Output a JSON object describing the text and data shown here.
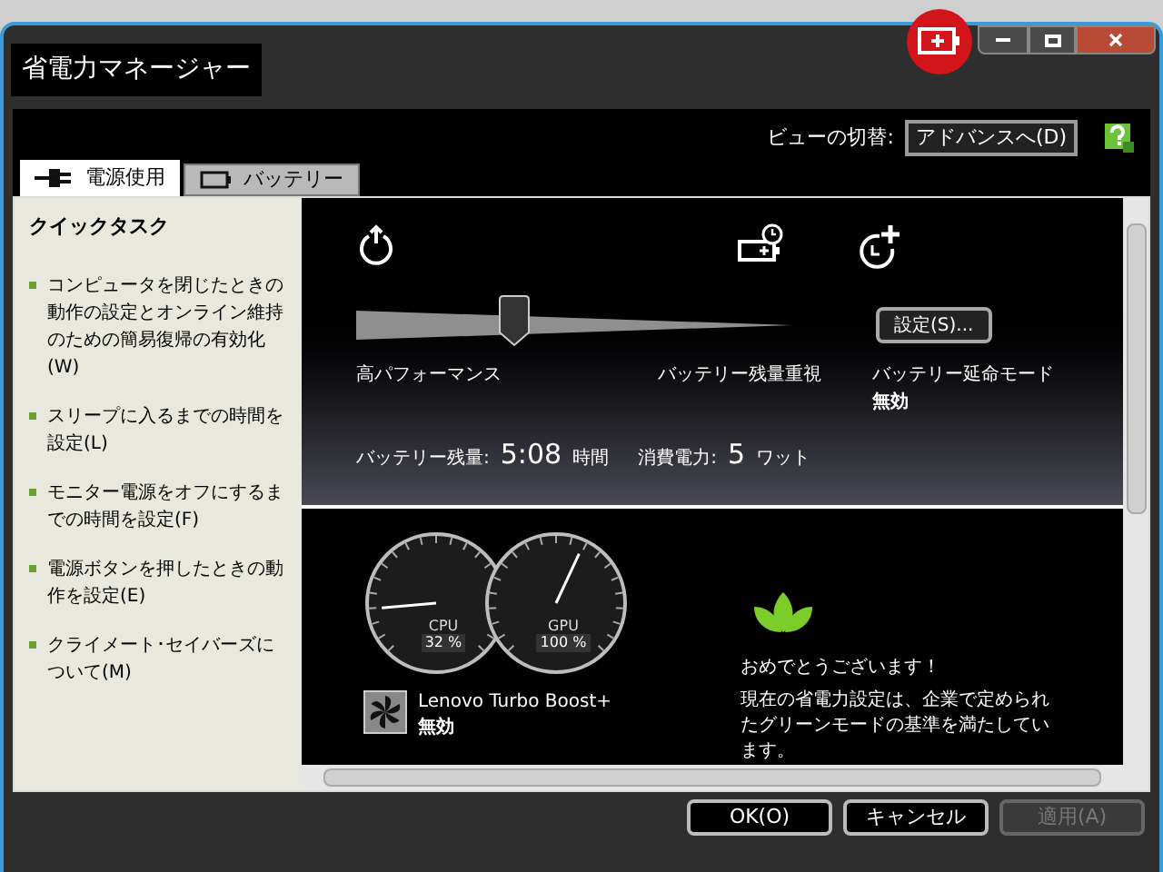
{
  "window": {
    "title": "省電力マネージャー"
  },
  "view_switch": {
    "label": "ビューの切替:",
    "button": "アドバンスへ(D)"
  },
  "tabs": [
    {
      "label": "電源使用",
      "kind": "plug",
      "selected": true
    },
    {
      "label": "バッテリー",
      "kind": "battery",
      "selected": false
    }
  ],
  "sidebar": {
    "title": "クイックタスク",
    "items": [
      "コンピュータを閉じたときの動作の設定とオンライン維持のための簡易復帰の有効化(W)",
      "スリープに入るまでの時間を設定(L)",
      "モニター電源をオフにするまでの時間を設定(F)",
      "電源ボタンを押したときの動作を設定(E)",
      "クライメート･セイバーズについて(M)"
    ]
  },
  "power_plan": {
    "slider": {
      "level": 0.35
    },
    "left_label": "高パフォーマンス",
    "right_label": "バッテリー残量重視",
    "settings_button": "設定(S)...",
    "extend_mode_label": "バッテリー延命モード",
    "extend_mode_value": "無効"
  },
  "stats": [
    {
      "label": "バッテリー残量:",
      "value": "5:08",
      "unit": "時間"
    },
    {
      "label": "消費電力:",
      "value": "5",
      "unit": "ワット"
    }
  ],
  "gauges": [
    {
      "name": "CPU",
      "reading": "32 %"
    },
    {
      "name": "GPU",
      "reading": "100 %"
    }
  ],
  "turbo_boost": {
    "name": "Lenovo Turbo Boost+",
    "value": "無効"
  },
  "green_message": {
    "title": "おめでとうございます！",
    "text": "現在の省電力設定は、企業で定められたグリーンモードの基準を満たしています。"
  },
  "buttons": [
    {
      "label": "OK(O)",
      "disabled": false
    },
    {
      "label": "キャンセル",
      "disabled": false
    },
    {
      "label": "適用(A)",
      "disabled": true
    }
  ]
}
